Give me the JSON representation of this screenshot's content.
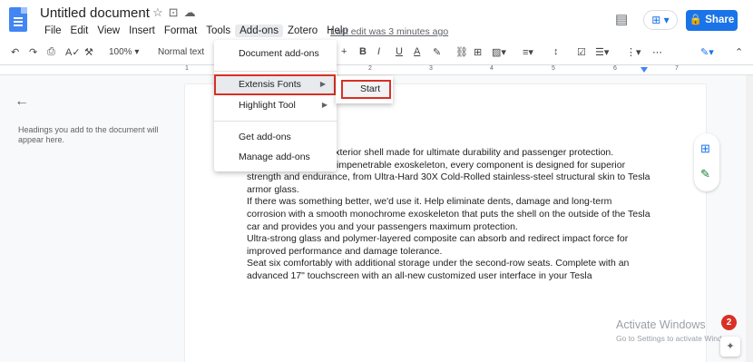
{
  "header": {
    "title": "Untitled document",
    "title_icons": [
      "star-icon",
      "folder-move-icon",
      "cloud-status-icon"
    ],
    "last_edit": "Last edit was 3 minutes ago",
    "share_label": "Share",
    "menu": [
      "File",
      "Edit",
      "View",
      "Insert",
      "Format",
      "Tools",
      "Add-ons",
      "Zotero",
      "Help"
    ]
  },
  "toolbar": {
    "zoom": "100%",
    "style": "Normal text"
  },
  "ruler": {
    "numbers": [
      "1",
      "1",
      "2",
      "3",
      "4",
      "5",
      "6",
      "7"
    ]
  },
  "outline": {
    "hint": "Headings you add to the document will appear here."
  },
  "addons_menu": {
    "items": [
      "Document add-ons",
      "Extensis Fonts",
      "Highlight Tool",
      "Get add-ons",
      "Manage add-ons"
    ],
    "submenu_start": "Start"
  },
  "document": {
    "lines": [
      "h an exterior shell made for ultimate durability and passenger protection.",
      "impenetrable exoskeleton, every component is designed for superior",
      "strength and endurance, from Ultra-Hard 30X Cold-Rolled stainless-steel structural skin to Tesla",
      "armor glass.",
      "If there was something better, we'd use it. Help eliminate dents, damage and long-term",
      "corrosion with a smooth monochrome exoskeleton that puts the shell on the outside of the Tesla",
      "car and provides you and your passengers maximum protection.",
      "Ultra-strong glass and polymer-layered composite can absorb and redirect impact force for",
      "improved performance and damage tolerance.",
      "Seat six comfortably with additional storage under the second-row seats. Complete with an",
      "advanced 17\" touchscreen with an all-new customized user interface in your Tesla"
    ]
  },
  "watermark": {
    "line1": "Activate Windows",
    "line2": "Go to Settings to activate Windows."
  },
  "badge_count": "2"
}
